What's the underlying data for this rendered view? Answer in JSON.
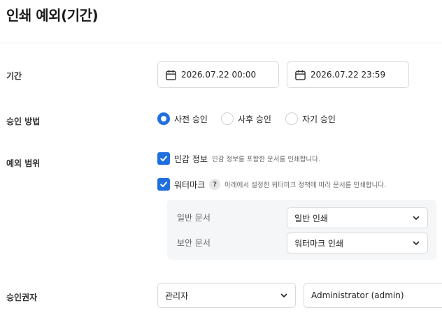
{
  "title": "인쇄 예외(기간)",
  "period": {
    "label": "기간",
    "start": "2026.07.22 00:00",
    "end": "2026.07.22 23:59"
  },
  "approval_method": {
    "label": "승인 방법",
    "options": [
      "사전 승인",
      "사후 승인",
      "자기 승인"
    ],
    "selected": "사전 승인"
  },
  "exception_scope": {
    "label": "예외 범위",
    "sensitive": {
      "label": "민감 정보",
      "description": "민감 정보를 포함한 문서를 인쇄합니다.",
      "checked": true
    },
    "watermark": {
      "label": "워터마크",
      "help": "?",
      "description": "아래에서 설정한 워터마크 정책에 따라 문서를 인쇄합니다.",
      "checked": true
    },
    "policies": [
      {
        "label": "일반 문서",
        "value": "일반 인쇄"
      },
      {
        "label": "보안 문서",
        "value": "워터마크 인쇄"
      }
    ]
  },
  "approver": {
    "label": "승인권자",
    "role": "관리자",
    "user": "Administrator (admin)"
  },
  "colors": {
    "accent": "#1f6fe0"
  }
}
